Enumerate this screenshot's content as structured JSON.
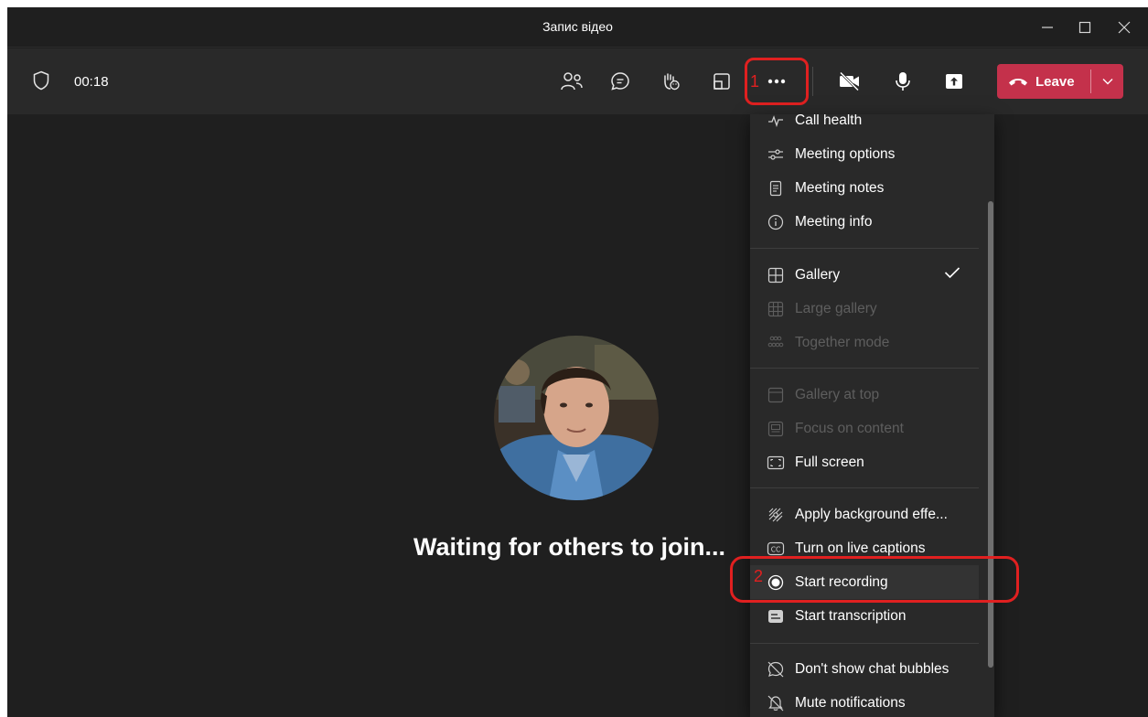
{
  "window": {
    "title": "Запис відео"
  },
  "toolbar": {
    "timer": "00:18",
    "leave_label": "Leave",
    "icons": [
      "shield-icon",
      "people-icon",
      "chat-icon",
      "raise-hand-icon",
      "share-tray-icon",
      "more-icon",
      "camera-off-icon",
      "mic-icon",
      "share-screen-icon",
      "phone-hangup-icon",
      "chevron-down-icon"
    ]
  },
  "annotations": {
    "first": "1",
    "second": "2",
    "color": "#e02020"
  },
  "stage": {
    "waiting_text": "Waiting for others to join..."
  },
  "menu": {
    "items": [
      {
        "label": "Call health",
        "icon": "pulse-icon",
        "enabled": true
      },
      {
        "label": "Meeting options",
        "icon": "sliders-icon",
        "enabled": true
      },
      {
        "label": "Meeting notes",
        "icon": "notes-icon",
        "enabled": true
      },
      {
        "label": "Meeting info",
        "icon": "info-icon",
        "enabled": true
      },
      {
        "label": "Gallery",
        "icon": "gallery-icon",
        "enabled": true,
        "checked": true
      },
      {
        "label": "Large gallery",
        "icon": "large-gallery-icon",
        "enabled": false
      },
      {
        "label": "Together mode",
        "icon": "together-mode-icon",
        "enabled": false
      },
      {
        "label": "Gallery at top",
        "icon": "gallery-top-icon",
        "enabled": false
      },
      {
        "label": "Focus on content",
        "icon": "focus-icon",
        "enabled": false
      },
      {
        "label": "Full screen",
        "icon": "fullscreen-icon",
        "enabled": true
      },
      {
        "label": "Apply background effe...",
        "icon": "background-effects-icon",
        "enabled": true
      },
      {
        "label": "Turn on live captions",
        "icon": "captions-icon",
        "enabled": true
      },
      {
        "label": "Start recording",
        "icon": "record-icon",
        "enabled": true
      },
      {
        "label": "Start transcription",
        "icon": "transcription-icon",
        "enabled": true
      },
      {
        "label": "Don't show chat bubbles",
        "icon": "chat-bubbles-off-icon",
        "enabled": true
      },
      {
        "label": "Mute notifications",
        "icon": "bell-off-icon",
        "enabled": true
      }
    ]
  },
  "colors": {
    "accent": "#7f85f5",
    "leave": "#c4314b",
    "background": "#1f1f1f",
    "toolbar": "#292929"
  }
}
